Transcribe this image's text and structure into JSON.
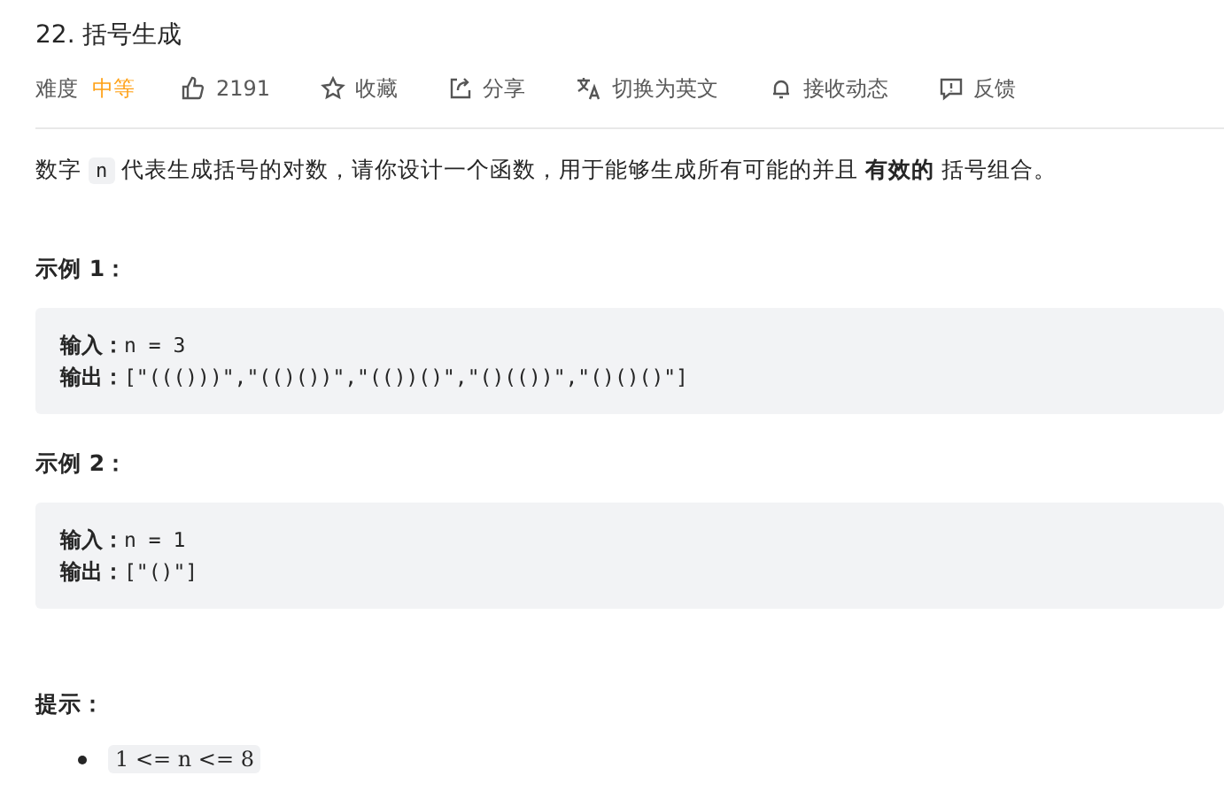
{
  "title": "22. 括号生成",
  "meta": {
    "difficulty_label": "难度",
    "difficulty": "中等",
    "actions": [
      {
        "kind": "like",
        "label": "2191"
      },
      {
        "kind": "favorite",
        "label": "收藏"
      },
      {
        "kind": "share",
        "label": "分享"
      },
      {
        "kind": "translate",
        "label": "切换为英文"
      },
      {
        "kind": "subscribe",
        "label": "接收动态"
      },
      {
        "kind": "feedback",
        "label": "反馈"
      }
    ]
  },
  "description": {
    "before": "数字",
    "code": "n",
    "after": "代表生成括号的对数，请你设计一个函数，用于能够生成所有可能的并且 **有效的** 括号组合。"
  },
  "examples": [
    {
      "heading": "示例 1：",
      "lines": [
        {
          "label": "输入：",
          "value": "n = 3"
        },
        {
          "label": "输出：",
          "value": "[\"((()))\",\"(()())\",\"(())()\",\"()(())\",\"()()()\"]"
        }
      ]
    },
    {
      "heading": "示例 2：",
      "lines": [
        {
          "label": "输入：",
          "value": "n = 1"
        },
        {
          "label": "输出：",
          "value": "[\"()\"]"
        }
      ]
    }
  ],
  "constraints": {
    "heading": "提示：",
    "items": [
      "1 <= n <= 8"
    ]
  }
}
